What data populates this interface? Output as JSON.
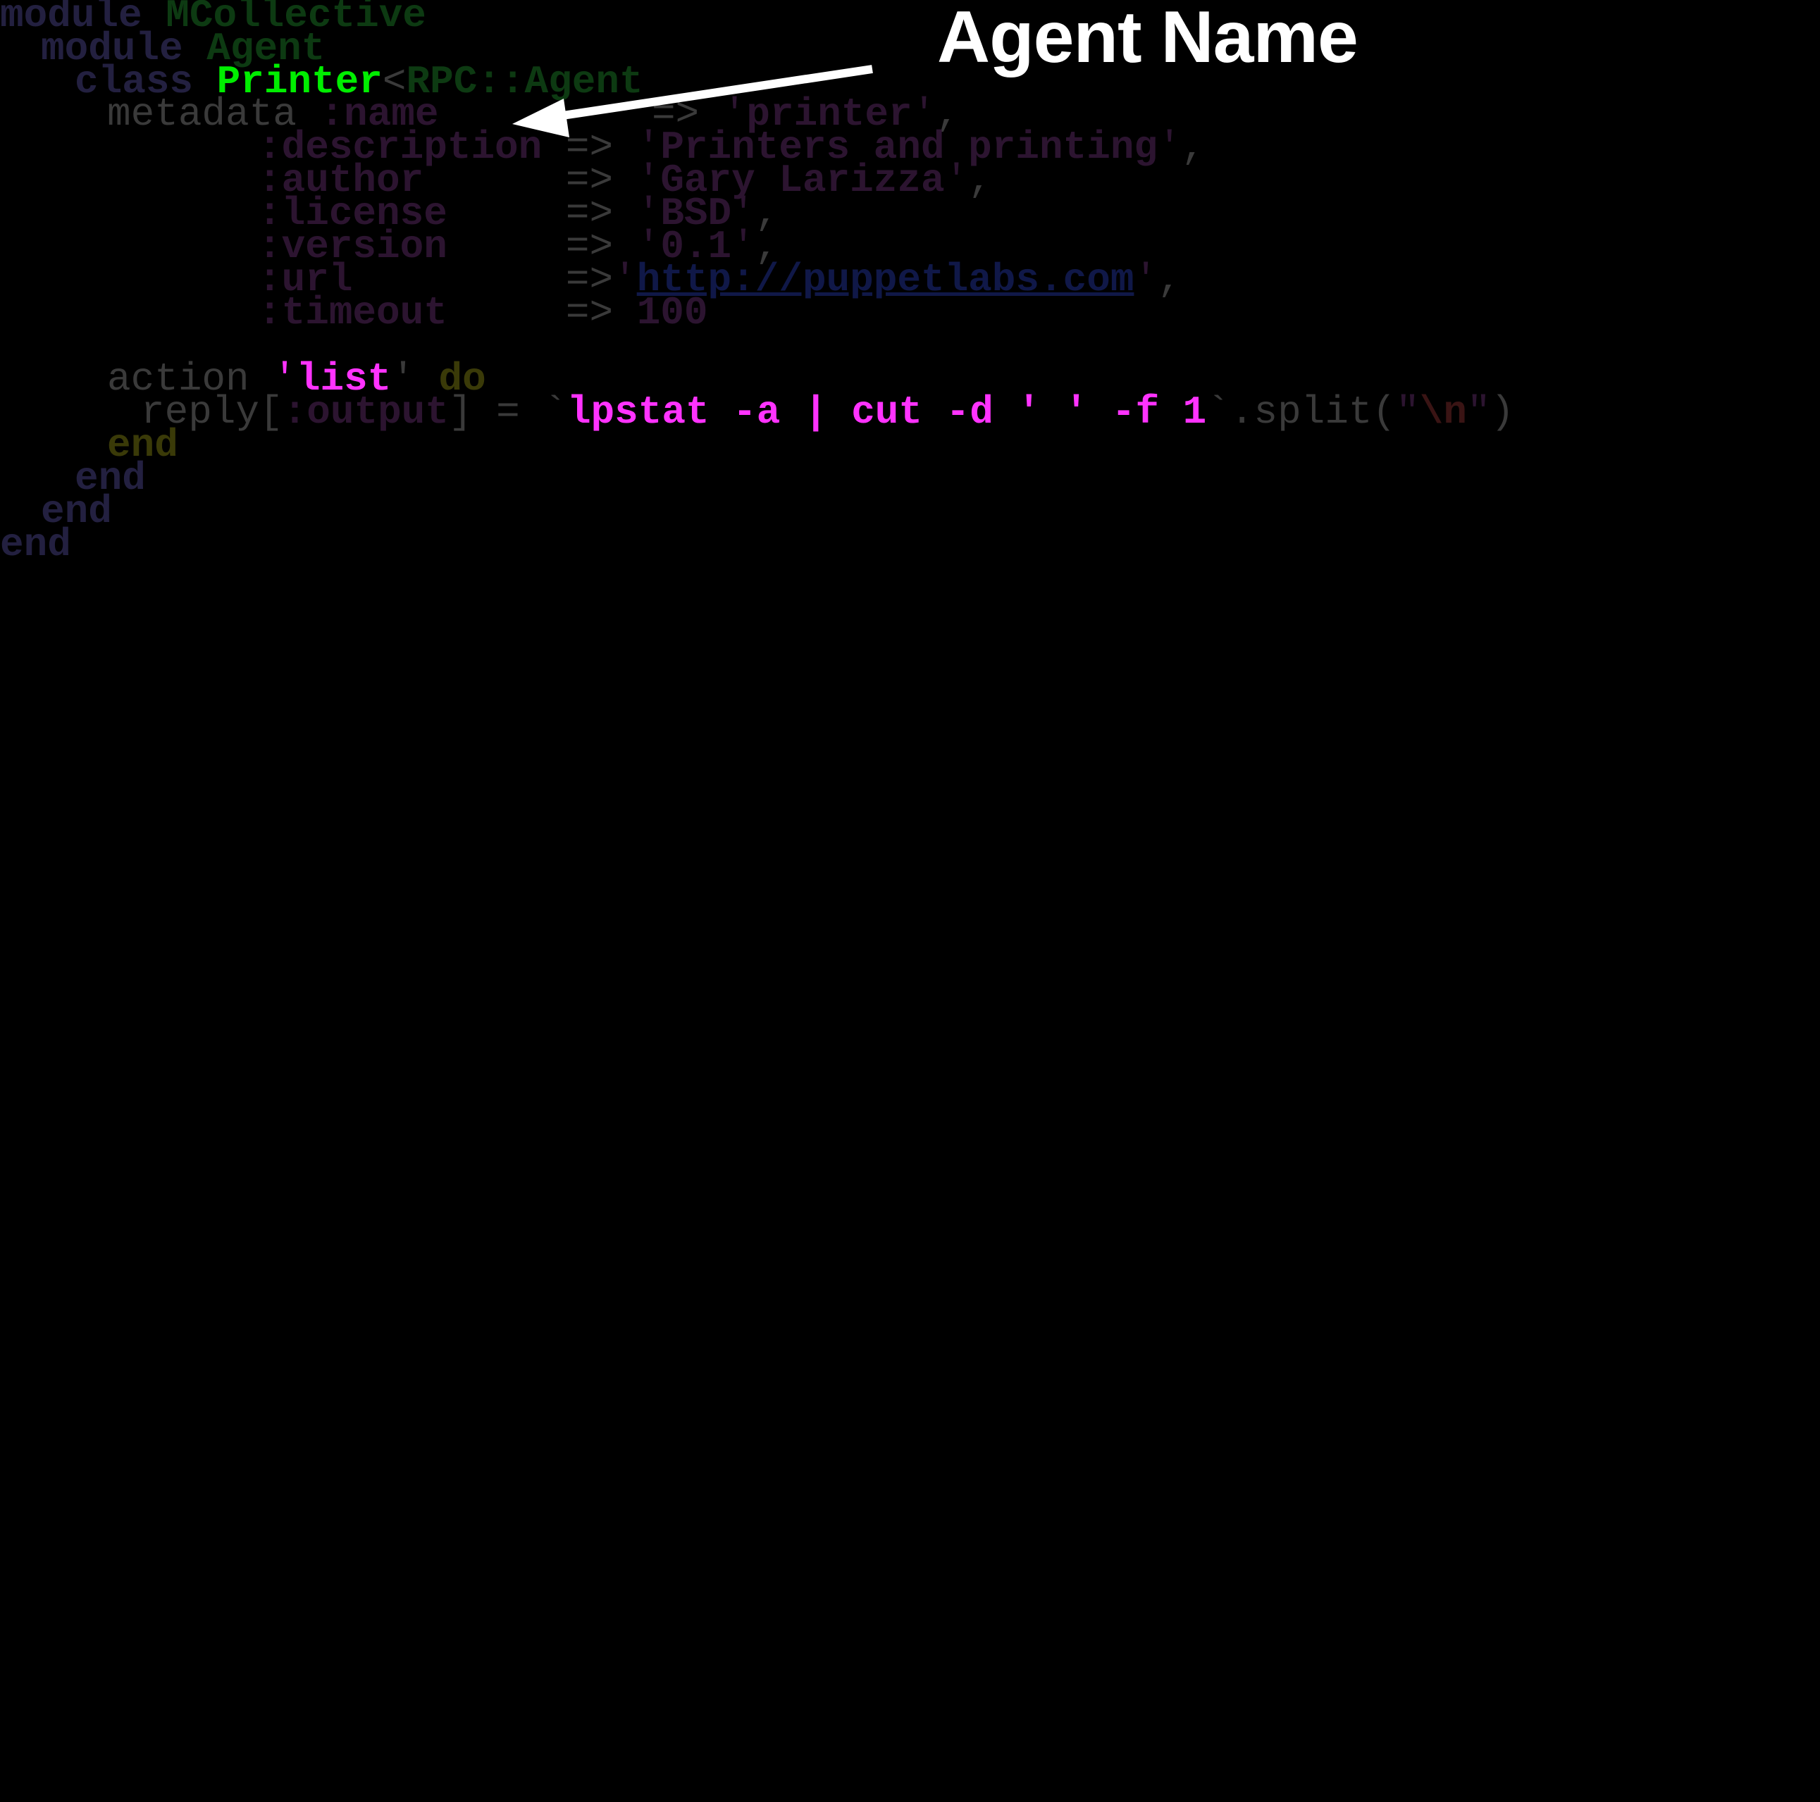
{
  "annotation": {
    "title": "Agent Name"
  },
  "colors": {
    "keyword_dim": "#232040",
    "constant_dim": "#0d3a12",
    "plain_dim": "#3a3a3a",
    "symbol_dim": "#2c1430",
    "string_dim": "#2c1430",
    "number_dim": "#2c1430",
    "do_dim": "#3a3a08",
    "link_dim": "#101848",
    "highlight_green": "#00ee00",
    "highlight_magenta": "#ff33ff",
    "highlight_white": "#ffffff"
  },
  "code": {
    "l1": {
      "kw": "module",
      "name": "MCollective"
    },
    "l2": {
      "kw": "module",
      "name": "Agent"
    },
    "l3": {
      "kw": "class",
      "name": "Printer",
      "op": "<",
      "parent": "RPC::Agent"
    },
    "l4": {
      "kw": "metadata",
      "sym": ":name",
      "arrow": "=>",
      "q1": "'",
      "val": "printer",
      "q2": "'",
      "comma": ","
    },
    "l5": {
      "sym": ":description",
      "arrow": "=>",
      "q1": "'",
      "val": "Printers and printing",
      "q2": "'",
      "comma": ","
    },
    "l6": {
      "sym": ":author",
      "arrow": "=>",
      "q1": "'",
      "val": "Gary Larizza",
      "q2": "'",
      "comma": ","
    },
    "l7": {
      "sym": ":license",
      "arrow": "=>",
      "q1": "'",
      "val": "BSD",
      "q2": "'",
      "comma": ","
    },
    "l8": {
      "sym": ":version",
      "arrow": "=>",
      "q1": "'",
      "val": "0.1",
      "q2": "'",
      "comma": ","
    },
    "l9": {
      "sym": ":url",
      "arrow": "=>",
      "q1": "'",
      "val": "http://puppetlabs.com",
      "q2": "'",
      "comma": ","
    },
    "l10": {
      "sym": ":timeout",
      "arrow": "=>",
      "val": "100"
    },
    "l11": {
      "kw": "action",
      "q1": "'",
      "val": "list",
      "q2": "'",
      "do": "do"
    },
    "l12": {
      "recv": "reply[",
      "sym": ":output",
      "rest": "] =",
      "bt1": "`",
      "cmd": "lpstat -a | cut -d ' ' -f 1",
      "bt2": "`",
      "split": ".split(",
      "dq1": "\"",
      "esc": "\\n",
      "dq2": "\"",
      "close": ")"
    },
    "l13": {
      "end": "end"
    },
    "l14": {
      "end": "end"
    },
    "l15": {
      "end": "end"
    },
    "l16": {
      "end": "end"
    }
  }
}
